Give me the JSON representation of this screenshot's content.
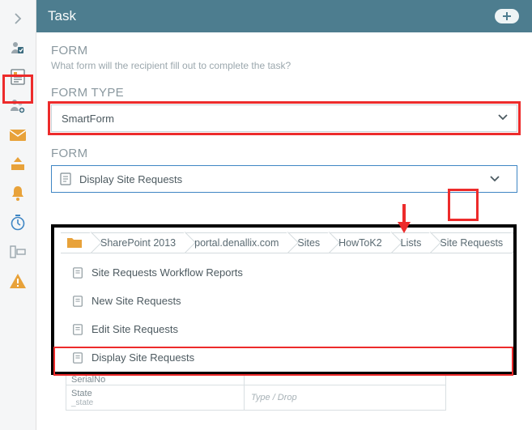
{
  "header": {
    "title": "Task"
  },
  "form": {
    "section_label": "FORM",
    "prompt": "What form will the recipient fill out to complete the task?",
    "type_label": "FORM TYPE",
    "type_value": "SmartForm",
    "form_label": "FORM",
    "selected_form": "Display Site Requests"
  },
  "dropdown": {
    "breadcrumbs": [
      "SharePoint 2013",
      "portal.denallix.com",
      "Sites",
      "HowToK2",
      "Lists",
      "Site Requests"
    ],
    "items": [
      "Site Requests Workflow Reports",
      "New Site Requests",
      "Edit Site Requests",
      "Display Site Requests"
    ]
  },
  "bgtable": {
    "row0": {
      "label": "SerialNo"
    },
    "row1": {
      "label": "State",
      "sub": "_state",
      "placeholder": "Type / Drop"
    }
  }
}
